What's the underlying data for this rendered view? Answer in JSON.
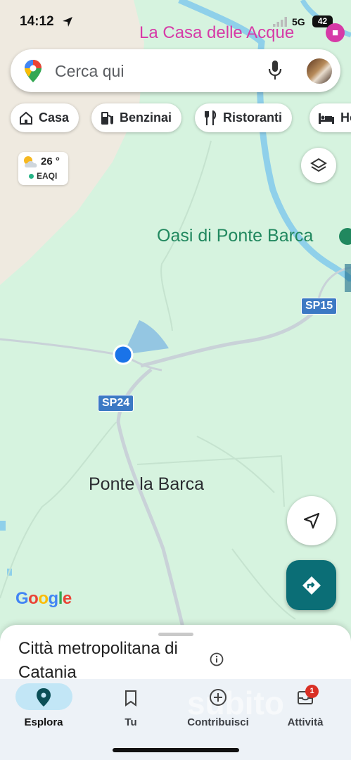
{
  "status_bar": {
    "time": "14:12",
    "network": "5G",
    "battery": "42",
    "location_icon": "location-arrow-icon"
  },
  "map": {
    "poi_hotel": "La Casa delle Acque",
    "poi_park": "Oasi di Ponte Barca",
    "locality": "Ponte la Barca",
    "road_sp15": "SP15",
    "road_sp24": "SP24",
    "attribution": [
      "G",
      "o",
      "o",
      "g",
      "l",
      "e"
    ],
    "attribution_colors": [
      "#4285f4",
      "#ea4335",
      "#fbbc05",
      "#4285f4",
      "#34a853",
      "#ea4335"
    ]
  },
  "search": {
    "placeholder": "Cerca qui",
    "logo_icon": "google-maps-pin-icon",
    "mic_icon": "microphone-icon"
  },
  "chips": [
    {
      "label": "Casa",
      "icon": "home-icon"
    },
    {
      "label": "Benzinai",
      "icon": "gas-station-icon"
    },
    {
      "label": "Ristoranti",
      "icon": "restaurant-icon"
    },
    {
      "label": "Ho",
      "icon": "hotel-icon"
    }
  ],
  "weather": {
    "temperature": "26 °",
    "aqi_label": "EAQI",
    "icon": "partly-cloudy-icon"
  },
  "sheet": {
    "title": "Città metropolitana di Catania"
  },
  "navbar": {
    "items": [
      {
        "label": "Esplora",
        "icon": "explore-pin-icon",
        "active": true
      },
      {
        "label": "Tu",
        "icon": "bookmark-icon",
        "active": false
      },
      {
        "label": "Contribuisci",
        "icon": "add-circle-icon",
        "active": false
      },
      {
        "label": "Attività",
        "icon": "inbox-icon",
        "active": false,
        "badge": "1"
      }
    ]
  },
  "watermark": "subito",
  "colors": {
    "map_land": "#d6f3df",
    "map_sand": "#efeae0",
    "water": "#8fd0ea",
    "accent_teal": "#0b6e76",
    "road_badge": "#3c79c4",
    "poi_pink": "#d63aa7",
    "park_green": "#21885f",
    "location_blue": "#1a73e8"
  }
}
